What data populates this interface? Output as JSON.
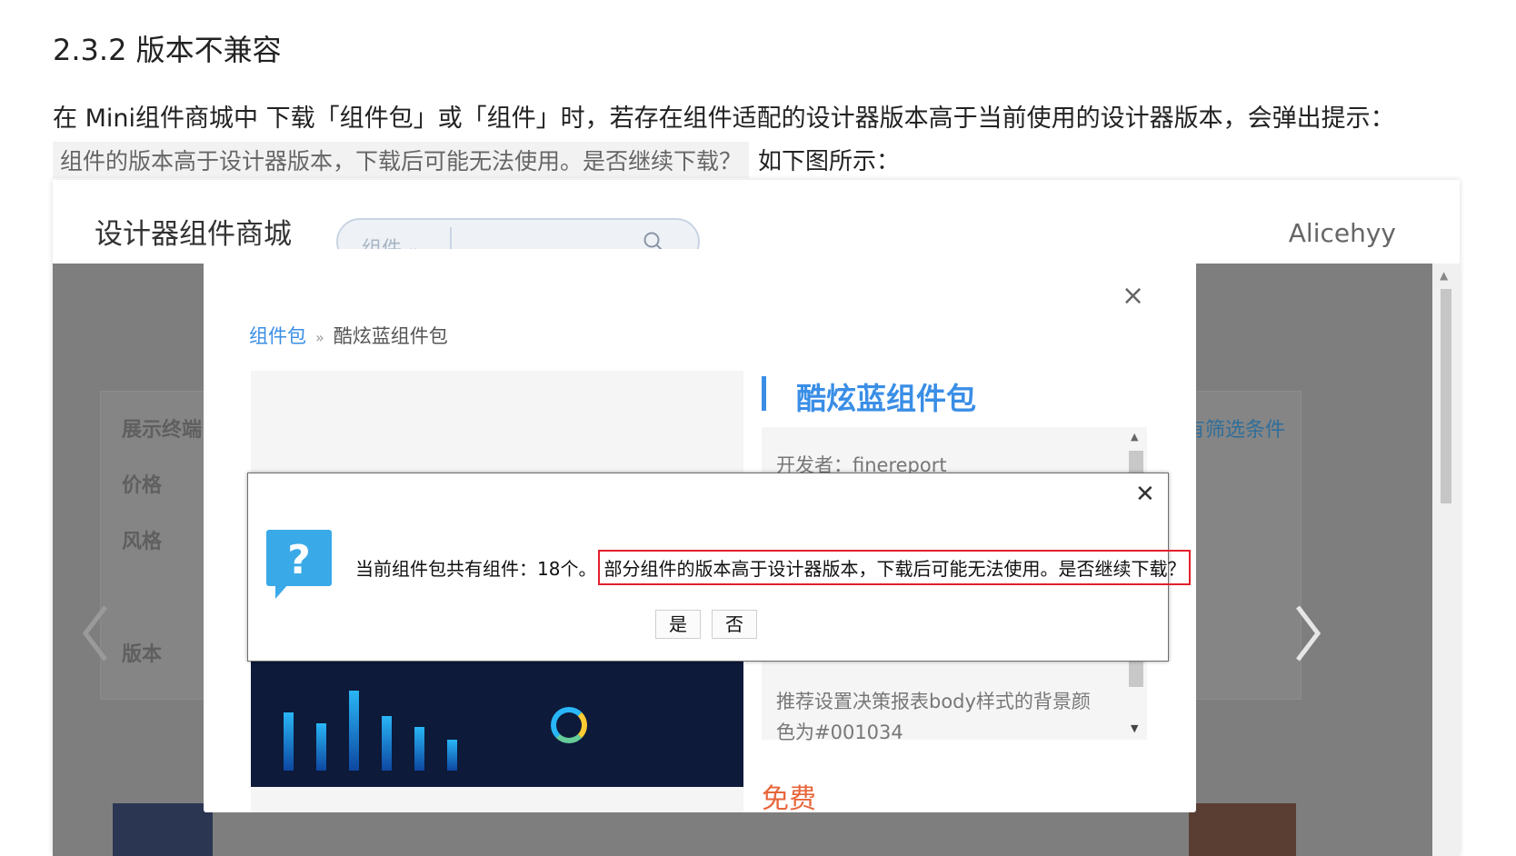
{
  "doc": {
    "heading": "2.3.2 版本不兼容",
    "paragraph": "在 Mini组件商城中 下载「组件包」或「组件」时，若存在组件适配的设计器版本高于当前使用的设计器版本，会弹出提示：",
    "code_text": "组件的版本高于设计器版本，下载后可能无法使用。是否继续下载？",
    "after_code": "如下图所示："
  },
  "app": {
    "title": "设计器组件商城",
    "search_select": "组件",
    "search_placeholder": "",
    "user": "Alicehyy"
  },
  "background": {
    "filters": [
      "展示终端",
      "价格",
      "风格",
      "版本"
    ],
    "filter_link": "有筛选条件"
  },
  "modal": {
    "breadcrumb_root": "组件包",
    "breadcrumb_sep": "»",
    "breadcrumb_current": "酷炫蓝组件包",
    "package_title": "酷炫蓝组件包",
    "developer": "开发者：finereport",
    "recommend_line1": "推荐设置决策报表body样式的背景颜",
    "recommend_line2": "色为#001034",
    "price": "免费"
  },
  "dialog": {
    "message_prefix": "当前组件包共有组件：18个。",
    "message_warning": "部分组件的版本高于设计器版本，下载后可能无法使用。是否继续下载？",
    "yes_label": "是",
    "no_label": "否"
  },
  "colors": {
    "accent_blue": "#3a8ee6",
    "price_orange": "#e8653a",
    "warning_red": "#e3202b",
    "question_icon": "#3aa9e8"
  }
}
